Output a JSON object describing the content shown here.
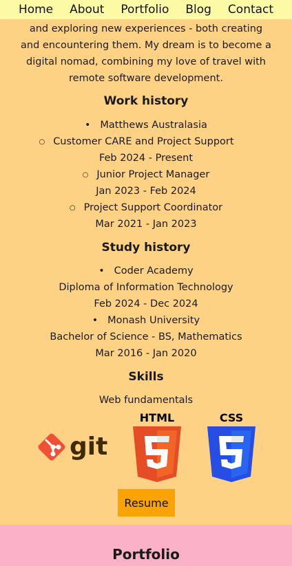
{
  "nav": {
    "items": [
      "Home",
      "About",
      "Portfolio",
      "Blog",
      "Contact"
    ]
  },
  "about": {
    "text": "and exploring new experiences - both creating and encountering them. My dream is to become a digital nomad, combining my love of travel with remote software development."
  },
  "work_history": {
    "heading": "Work history",
    "employer": "Matthews Australasia",
    "roles": [
      {
        "title": "Customer CARE and Project Support",
        "dates": "Feb 2024 - Present"
      },
      {
        "title": "Junior Project Manager",
        "dates": "Jan 2023 - Feb 2024"
      },
      {
        "title": "Project Support Coordinator",
        "dates": "Mar 2021 - Jan 2023"
      }
    ]
  },
  "study_history": {
    "heading": "Study history",
    "items": [
      {
        "institution": "Coder Academy",
        "course": "Diploma of Information Technology",
        "dates": "Feb 2024 - Dec 2024"
      },
      {
        "institution": "Monash University",
        "course": "Bachelor of Science - BS, Mathematics",
        "dates": "Mar 2016 - Jan 2020"
      }
    ]
  },
  "skills": {
    "heading": "Skills",
    "subheading": "Web fundamentals",
    "logos": {
      "git": "git",
      "html": "HTML",
      "css": "CSS"
    }
  },
  "resume_button": "Resume",
  "portfolio": {
    "heading": "Portfolio"
  },
  "colors": {
    "page_bg": "#fed285",
    "nav_bg": "#fdfaa5",
    "button_bg": "#f9a305",
    "portfolio_bg": "#fbb2c9",
    "git_orange": "#f05033",
    "html_orange": "#e44d26",
    "css_blue": "#264de4"
  }
}
